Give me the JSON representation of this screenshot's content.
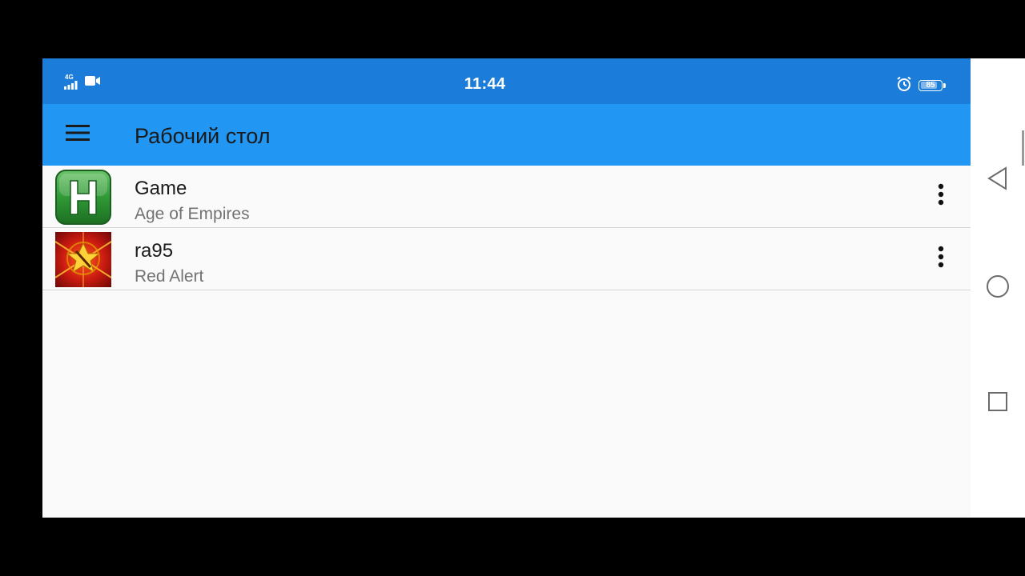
{
  "status_bar": {
    "time": "11:44",
    "network_label": "4G",
    "battery_level": "85",
    "battery_fraction": 0.85,
    "left_icons": [
      "signal-icon",
      "video-camera-icon"
    ],
    "right_icons": [
      "alarm-icon",
      "battery-icon"
    ],
    "background_color": "#1b7dd9"
  },
  "toolbar": {
    "title": "Рабочий стол",
    "menu_icon": "hamburger-menu-icon",
    "background_color": "#2196f3"
  },
  "items": [
    {
      "title": "Game",
      "subtitle": "Age of Empires",
      "icon": "green-h-app-icon",
      "menu_icon": "more-vertical-icon"
    },
    {
      "title": "ra95",
      "subtitle": "Red Alert",
      "icon": "red-alert-app-icon",
      "menu_icon": "more-vertical-icon"
    }
  ],
  "nav_bar": {
    "buttons": [
      "back-icon",
      "home-icon",
      "recents-icon"
    ]
  }
}
